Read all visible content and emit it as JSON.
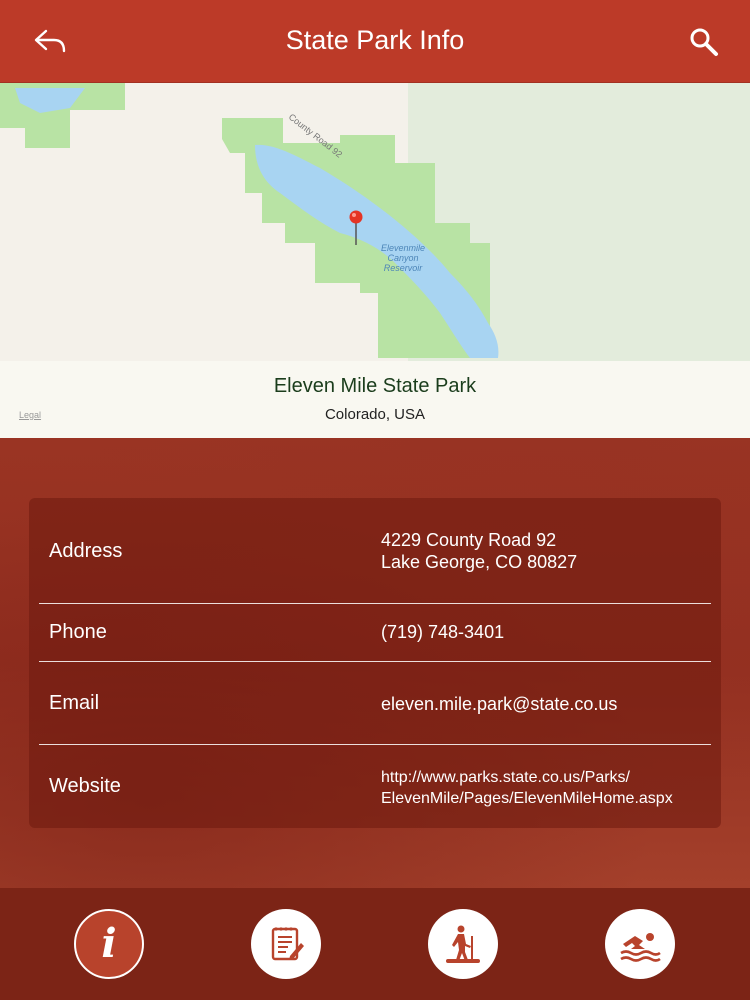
{
  "header": {
    "title": "State Park Info",
    "back_icon": "back-arrow-icon",
    "search_icon": "search-icon"
  },
  "map": {
    "park_name": "Eleven Mile State Park",
    "region": "Colorado, USA",
    "road_label": "County Road 92",
    "reservoir_label_1": "Elevenmile",
    "reservoir_label_2": "Canyon",
    "reservoir_label_3": "Reservoir",
    "legal": "Legal"
  },
  "info": {
    "address_label": "Address",
    "address_line1": "4229 County Road 92",
    "address_line2": "Lake George, CO 80827",
    "phone_label": "Phone",
    "phone_value": "(719) 748-3401",
    "email_label": "Email",
    "email_value": "eleven.mile.park@state.co.us",
    "website_label": "Website",
    "website_line1": "http://www.parks.state.co.us/Parks/",
    "website_line2": "ElevenMile/Pages/ElevenMileHome.aspx"
  },
  "tabs": [
    {
      "icon": "info-icon",
      "active": true,
      "glyph": "i"
    },
    {
      "icon": "notes-icon",
      "active": false
    },
    {
      "icon": "hiking-icon",
      "active": false
    },
    {
      "icon": "swimming-icon",
      "active": false
    }
  ],
  "colors": {
    "header": "#bc3a28",
    "content": "#932f20",
    "tabbar": "#7c2416",
    "park_green": "#b8e3a4",
    "water": "#a8d4f2"
  }
}
